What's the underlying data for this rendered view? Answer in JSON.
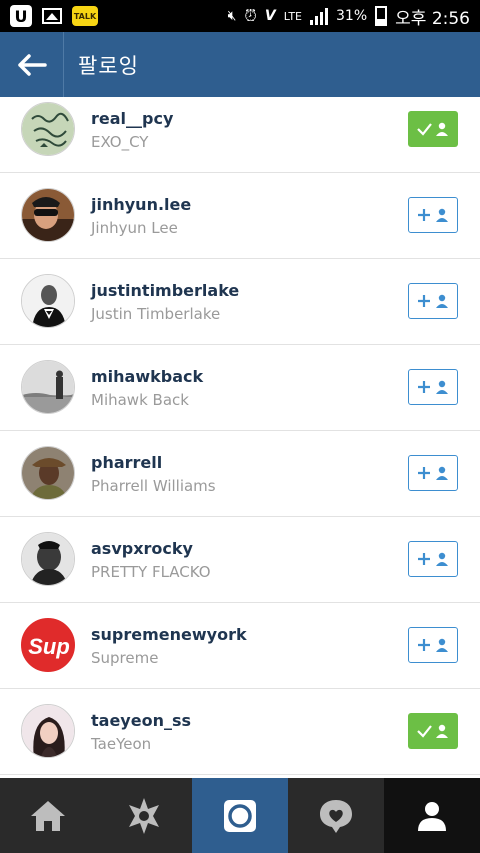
{
  "status_bar": {
    "app_u": "U",
    "talk_label": "TALK",
    "lte": "LTE",
    "battery": "31%",
    "time": "오후 2:56"
  },
  "header": {
    "title": "팔로잉"
  },
  "users": [
    {
      "username": "real__pcy",
      "fullname": "EXO_CY",
      "following": true
    },
    {
      "username": "jinhyun.lee",
      "fullname": "Jinhyun Lee",
      "following": false
    },
    {
      "username": "justintimberlake",
      "fullname": "Justin Timberlake",
      "following": false
    },
    {
      "username": "mihawkback",
      "fullname": "Mihawk Back",
      "following": false
    },
    {
      "username": "pharrell",
      "fullname": "Pharrell Williams",
      "following": false
    },
    {
      "username": "asvpxrocky",
      "fullname": "PRETTY FLACKO",
      "following": false
    },
    {
      "username": "supremenewyork",
      "fullname": "Supreme",
      "following": false
    },
    {
      "username": "taeyeon_ss",
      "fullname": "TaeYeon",
      "following": true
    }
  ],
  "avatars": {
    "supreme_logo_text": "Sup"
  },
  "colors": {
    "header": "#2f5e8f",
    "following_button": "#6cbf45",
    "follow_button_border": "#3d8ed0",
    "nav_bg": "#2a2a2a"
  }
}
